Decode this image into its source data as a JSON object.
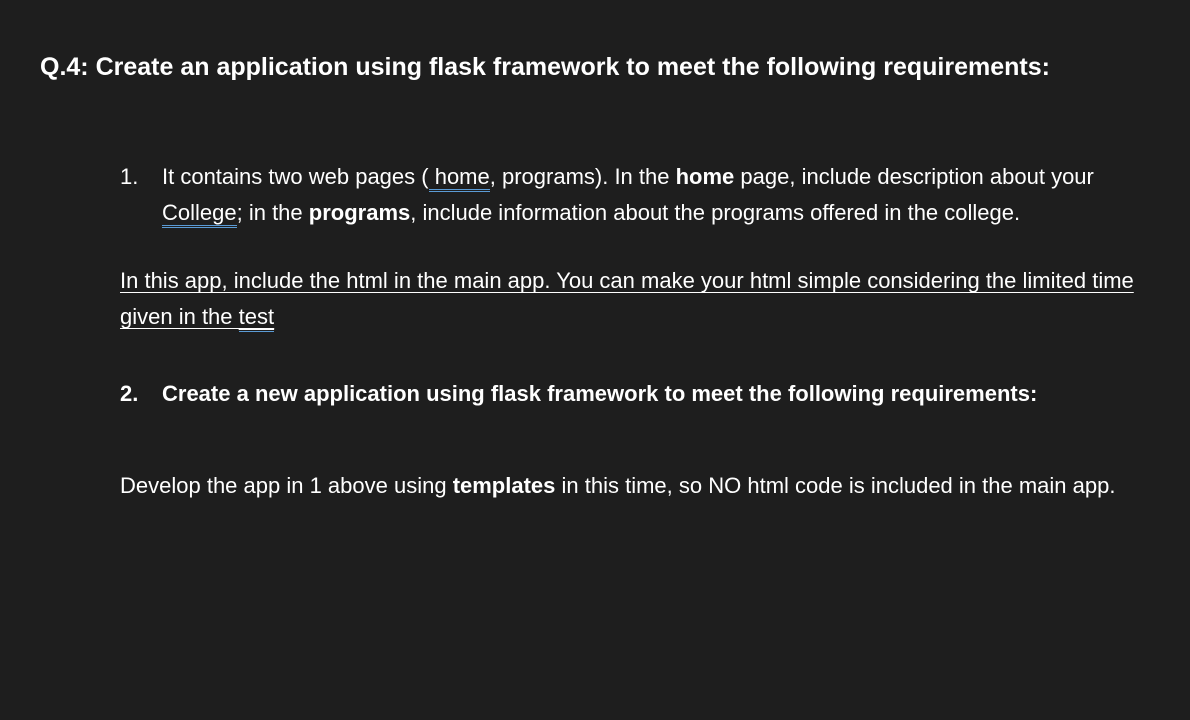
{
  "heading": {
    "prefix": "Q.4: ",
    "text": "Create an application using flask framework to meet the following requirements:"
  },
  "items": {
    "num1": "1.",
    "item1": {
      "t1": "It contains two web pages (",
      "home_u": " home",
      "t2": ", programs). In the ",
      "home_b": "home",
      "t3": " page, include description about your ",
      "college_u": "College",
      "t4": "; in the ",
      "programs_b": "programs",
      "t5": ", include information about the programs offered in the college."
    },
    "note": {
      "t1": "In this app, include the html in the main app. You can make your html simple considering the limited time given in the ",
      "test_u": "test"
    },
    "num2": "2.",
    "item2": "Create a new application using flask framework to meet the following requirements:",
    "para": {
      "t1": "Develop the app in 1 above using ",
      "templates_b": "templates",
      "t2": " in this time, so NO html code is included in the main app."
    }
  }
}
